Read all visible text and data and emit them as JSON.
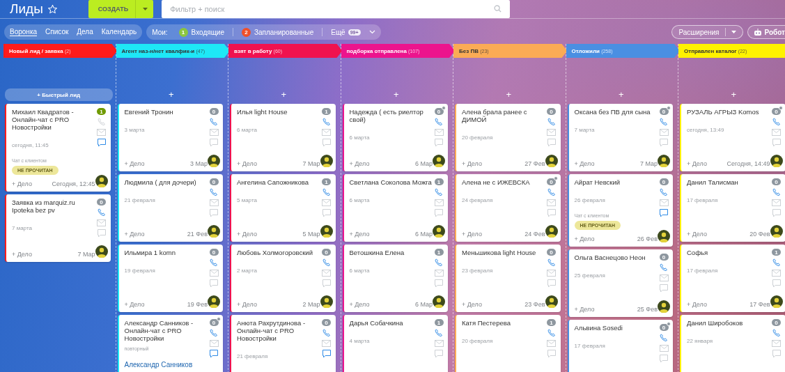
{
  "page": {
    "title": "Лиды",
    "starred": false
  },
  "create_button": {
    "label": "СОЗДАТЬ"
  },
  "search": {
    "placeholder": "Фильтр + поиск"
  },
  "view_tabs": [
    {
      "label": "Воронка",
      "selected": true
    },
    {
      "label": "Список",
      "selected": false
    },
    {
      "label": "Дела",
      "selected": false
    },
    {
      "label": "Календарь",
      "selected": false
    }
  ],
  "my_filter": {
    "label": "Мои:",
    "items": [
      {
        "count": "1",
        "label": "Входящие",
        "color": "#8cc63f"
      },
      {
        "count": "2",
        "label": "Запланированные",
        "color": "#f0502a"
      }
    ],
    "more": {
      "label": "Ещё",
      "count": "99+"
    }
  },
  "extensions_button": {
    "label": "Расширения"
  },
  "robots_button": {
    "label": "Робот"
  },
  "columns": [
    {
      "title": "Новый лид / заявка",
      "count": "(2)",
      "color": "#ff1b1b",
      "add": {
        "kind": "wide",
        "label": "+ Быстрый лид"
      },
      "cards": [
        {
          "title": "Михаил Квадратов - Онлайн-чат с PRO Новостройки",
          "count": "1",
          "count_highlighted": true,
          "notify": false,
          "phone_active": false,
          "chat_active": true,
          "date": "сегодня, 11:45",
          "chat_label": "Чат с клиентом",
          "status": "НЕ ПРОЧИТАН",
          "footer": {
            "action": "+ Дело",
            "date": "Сегодня, 12:45"
          }
        },
        {
          "title": "Заявка из marquiz.ru Ipoteka bez pv",
          "count": "0",
          "count_highlighted": false,
          "notify": false,
          "phone_active": true,
          "chat_active": false,
          "date": "7 марта",
          "footer": {
            "action": "+ Дело",
            "date": "7 Мар"
          }
        }
      ]
    },
    {
      "title": "Агент наз-н/нет квалфик-и",
      "count": "(47)",
      "color": "#1ee8f6",
      "add": {
        "kind": "plain",
        "label": "+"
      },
      "cards": [
        {
          "title": "Евгений Тронин",
          "count": "0",
          "count_highlighted": false,
          "notify": false,
          "phone_active": true,
          "chat_active": false,
          "date": "3 марта",
          "footer": {
            "action": "+ Дело",
            "date": "3 Мар"
          }
        },
        {
          "title": "Людмила ( для дочери)",
          "count": "0",
          "count_highlighted": false,
          "notify": false,
          "phone_active": true,
          "chat_active": false,
          "date": "21 февраля",
          "footer": {
            "action": "+ Дело",
            "date": "21 Фев"
          }
        },
        {
          "title": "Ильмира 1 komn",
          "count": "0",
          "count_highlighted": false,
          "notify": false,
          "phone_active": true,
          "chat_active": false,
          "date": "19 февраля",
          "footer": {
            "action": "+ Дело",
            "date": "19 Фев"
          }
        },
        {
          "title": "Александр Санников - Онлайн-чат с PRO Новостройки",
          "count": "0",
          "count_highlighted": false,
          "notify": true,
          "phone_active": true,
          "chat_active": true,
          "note": "повторный",
          "link": "Александр Санников"
        }
      ]
    },
    {
      "title": "взят в работу",
      "count": "(60)",
      "color": "#f0124f",
      "add": {
        "kind": "plain",
        "label": "+"
      },
      "cards": [
        {
          "title": "Илья light House",
          "count": "1",
          "count_highlighted": false,
          "notify": false,
          "phone_active": true,
          "chat_active": false,
          "date": "6 марта",
          "footer": {
            "action": "+ Дело",
            "date": "7 Мар"
          }
        },
        {
          "title": "Ангелина Сапожникова",
          "count": "1",
          "count_highlighted": false,
          "notify": false,
          "phone_active": true,
          "chat_active": false,
          "date": "5 марта",
          "footer": {
            "action": "+ Дело",
            "date": "5 Мар"
          }
        },
        {
          "title": "Любовь Холмогоровский",
          "count": "0",
          "count_highlighted": false,
          "notify": false,
          "phone_active": true,
          "chat_active": false,
          "date": "2 марта",
          "footer": {
            "action": "+ Дело",
            "date": "2 Мар"
          }
        },
        {
          "title": "Анюта Рахрутдинова - Онлайн-чат с PRO Новостройки",
          "count": "0",
          "count_highlighted": false,
          "notify": false,
          "phone_active": true,
          "chat_active": true,
          "date": "21 февраля"
        }
      ]
    },
    {
      "title": "подборка отправлена",
      "count": "(107)",
      "color": "#ec148d",
      "add": {
        "kind": "plain",
        "label": "+"
      },
      "cards": [
        {
          "title": "Надежда ( есть риелтор свой)",
          "count": "0",
          "count_highlighted": false,
          "notify": true,
          "phone_active": true,
          "chat_active": false,
          "date": "6 марта",
          "footer": {
            "action": "+ Дело",
            "date": "6 Мар"
          }
        },
        {
          "title": "Светлана Соколова Можга",
          "count": "1",
          "count_highlighted": false,
          "notify": false,
          "phone_active": true,
          "chat_active": false,
          "date": "6 марта",
          "footer": {
            "action": "+ Дело",
            "date": "6 Мар"
          }
        },
        {
          "title": "Ветошкина Елена",
          "count": "1",
          "count_highlighted": false,
          "notify": false,
          "phone_active": true,
          "chat_active": false,
          "date": "6 марта",
          "footer": {
            "action": "+ Дело",
            "date": "6 Мар"
          }
        },
        {
          "title": "Дарья Собачкина",
          "count": "1",
          "count_highlighted": false,
          "notify": false,
          "phone_active": true,
          "chat_active": false,
          "date": "4 марта"
        }
      ]
    },
    {
      "title": "Без ПВ",
      "count": "(23)",
      "color": "#fbab55",
      "add": {
        "kind": "plain",
        "label": "+"
      },
      "cards": [
        {
          "title": "Алена брала ранее с ДИМОЙ",
          "count": "0",
          "count_highlighted": false,
          "notify": false,
          "phone_active": true,
          "chat_active": false,
          "date": "20 февраля",
          "footer": {
            "action": "+ Дело",
            "date": "27 Фев"
          }
        },
        {
          "title": "Алена не с ИЖЕВСКА",
          "count": "0",
          "count_highlighted": false,
          "notify": true,
          "phone_active": true,
          "chat_active": false,
          "date": "24 февраля",
          "footer": {
            "action": "+ Дело",
            "date": "24 Фев"
          }
        },
        {
          "title": "Меньшикова light House",
          "count": "0",
          "count_highlighted": false,
          "notify": false,
          "phone_active": true,
          "chat_active": false,
          "date": "23 февраля",
          "footer": {
            "action": "+ Дело",
            "date": "23 Фев"
          }
        },
        {
          "title": "Катя Пестерева",
          "count": "1",
          "count_highlighted": false,
          "notify": false,
          "phone_active": true,
          "chat_active": false,
          "date": "20 февраля"
        }
      ]
    },
    {
      "title": "Отложили",
      "count": "(258)",
      "color": "#4a8fe2",
      "add": {
        "kind": "plain",
        "label": "+"
      },
      "cards": [
        {
          "title": "Оксана без ПВ для сына",
          "count": "0",
          "count_highlighted": false,
          "notify": true,
          "phone_active": true,
          "chat_active": false,
          "date": "7 марта",
          "footer": {
            "action": "+ Дело",
            "date": "7 Мар"
          }
        },
        {
          "title": "Айрат Невский",
          "count": "0",
          "count_highlighted": false,
          "notify": false,
          "phone_active": true,
          "chat_active": true,
          "date": "26 февраля",
          "chat_label": "Чат с клиентом",
          "status": "НЕ ПРОЧИТАН",
          "footer": {
            "action": "+ Дело",
            "date": "26 Фев"
          }
        },
        {
          "title": "Ольга Васнецово Неон",
          "count": "0",
          "count_highlighted": false,
          "notify": false,
          "phone_active": true,
          "chat_active": false,
          "date": "25 февраля",
          "footer": {
            "action": "+ Дело",
            "date": "25 Фев"
          }
        },
        {
          "title": "Альвина Sosedi",
          "count": "0",
          "count_highlighted": false,
          "notify": true,
          "phone_active": true,
          "chat_active": false,
          "date": "17 февраля"
        }
      ]
    },
    {
      "title": "Отправлен каталог",
      "count": "(22)",
      "color": "#fff200",
      "add": {
        "kind": "plain",
        "label": "+"
      },
      "cards": [
        {
          "title": "РУЗАЛЬ АГРЫЗ Komos",
          "count": "0",
          "count_highlighted": false,
          "notify": true,
          "phone_active": true,
          "chat_active": false,
          "date": "сегодня, 13:49",
          "footer": {
            "action": "+ Дело",
            "date": "Сегодня, 14:49"
          }
        },
        {
          "title": "Данил Талисман",
          "count": "0",
          "count_highlighted": false,
          "notify": false,
          "phone_active": true,
          "chat_active": false,
          "date": "17 февраля",
          "footer": {
            "action": "+ Дело",
            "date": "20 Фев"
          }
        },
        {
          "title": "Софья",
          "count": "1",
          "count_highlighted": false,
          "notify": false,
          "phone_active": true,
          "chat_active": false,
          "date": "17 февраля",
          "footer": {
            "action": "+ Дело",
            "date": "17 Фев"
          }
        },
        {
          "title": "Данил Широбоков",
          "count": "0",
          "count_highlighted": false,
          "notify": false,
          "phone_active": true,
          "chat_active": false,
          "date": "22 января"
        }
      ]
    }
  ]
}
